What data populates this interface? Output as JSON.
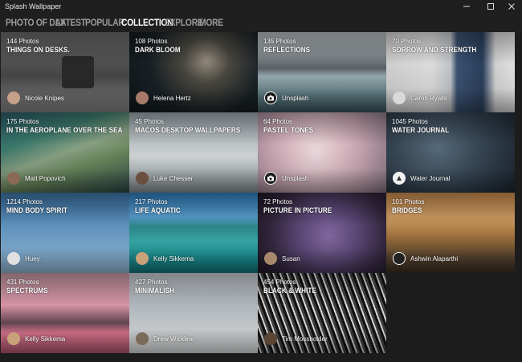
{
  "window": {
    "title": "Splash Wallpaper"
  },
  "nav": [
    {
      "label": "PHOTO OF DAY",
      "active": false
    },
    {
      "label": "LATEST",
      "active": false
    },
    {
      "label": "POPULAR",
      "active": false
    },
    {
      "label": "COLLECTION",
      "active": true
    },
    {
      "label": "EXPLORE",
      "active": false
    },
    {
      "label": "MORE",
      "active": false
    }
  ],
  "collections": [
    {
      "count": "144 Photos",
      "title": "THINGS ON DESKS.",
      "author": "Nicole Knipes",
      "avatar": "person"
    },
    {
      "count": "108 Photos",
      "title": "DARK BLOOM",
      "author": "Helena Hertz",
      "avatar": "person"
    },
    {
      "count": "135 Photos",
      "title": "REFLECTIONS",
      "author": "Unsplash",
      "avatar": "camera-icon"
    },
    {
      "count": "70 Photos",
      "title": "SORROW AND STRENGTH",
      "author": "Caron Ryalls",
      "avatar": "blank"
    },
    {
      "count": "175 Photos",
      "title": "IN THE AEROPLANE OVER THE SEA",
      "author": "Matt Popovich",
      "avatar": "person"
    },
    {
      "count": "45 Photos",
      "title": "MACOS DESKTOP WALLPAPERS",
      "author": "Luke Chesser",
      "avatar": "person"
    },
    {
      "count": "64 Photos",
      "title": "PASTEL TONES",
      "author": "Unsplash",
      "avatar": "camera-icon"
    },
    {
      "count": "1045 Photos",
      "title": "WATER JOURNAL",
      "author": "Water Journal",
      "avatar": "logo"
    },
    {
      "count": "1214 Photos",
      "title": "MIND BODY SPIRIT",
      "author": "Huey",
      "avatar": "blank"
    },
    {
      "count": "217 Photos",
      "title": "LIFE AQUATIC",
      "author": "Kelly Sikkema",
      "avatar": "person"
    },
    {
      "count": "72 Photos",
      "title": "PICTURE IN PICTURE",
      "author": "Susan",
      "avatar": "person"
    },
    {
      "count": "101 Photos",
      "title": "BRIDGES",
      "author": "Ashwin Alaparthi",
      "avatar": "person"
    },
    {
      "count": "431 Photos",
      "title": "SPECTRUMS",
      "author": "Kelly Sikkema",
      "avatar": "person"
    },
    {
      "count": "427 Photos",
      "title": "MINIMALISH",
      "author": "Drew Wickline",
      "avatar": "person"
    },
    {
      "count": "454 Photos",
      "title": "BLACK & WHITE",
      "author": "Tim Mossholder",
      "avatar": "person"
    }
  ]
}
